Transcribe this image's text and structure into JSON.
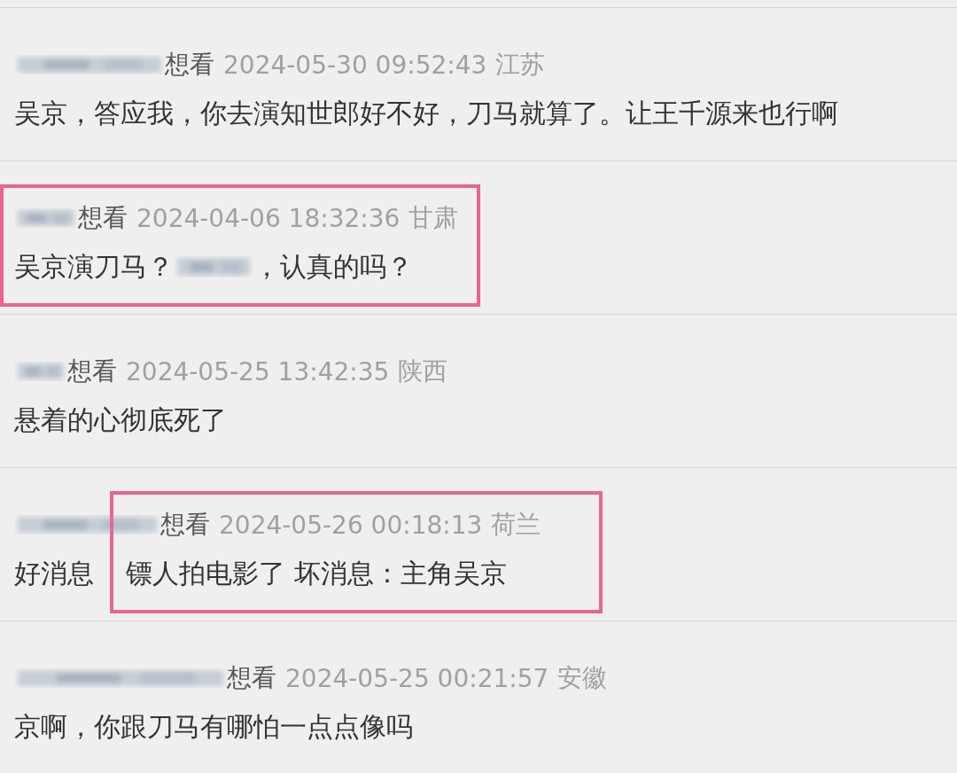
{
  "comments": [
    {
      "reaction": "想看",
      "date": "2024-05-30 09:52:43",
      "location": "江苏",
      "segments": [
        {
          "kind": "text",
          "text": "吴京，答应我，你去演知世郎好不好，刀马就算了。让王千源来也行啊"
        }
      ],
      "highlighted": false
    },
    {
      "reaction": "想看",
      "date": "2024-04-06 18:32:36",
      "location": "甘肃",
      "segments": [
        {
          "kind": "text",
          "text": "吴京演刀马？"
        },
        {
          "kind": "redacted"
        },
        {
          "kind": "text",
          "text": "，认真的吗？"
        }
      ],
      "highlighted": true,
      "name_outside_highlight": false
    },
    {
      "reaction": "想看",
      "date": "2024-05-25 13:42:35",
      "location": "陕西",
      "segments": [
        {
          "kind": "text",
          "text": "悬着的心彻底死了"
        }
      ],
      "highlighted": false
    },
    {
      "reaction": "想看",
      "date": "2024-05-26 00:18:13",
      "location": "荷兰",
      "segments": [
        {
          "kind": "text",
          "text": "好消息"
        },
        {
          "kind": "text",
          "text": "镖人拍电影了 坏消息：主角吴京"
        }
      ],
      "highlighted": true,
      "name_outside_highlight": true
    },
    {
      "reaction": "想看",
      "date": "2024-05-25 00:21:57",
      "location": "安徽",
      "segments": [
        {
          "kind": "text",
          "text": "京啊，你跟刀马有哪怕一点点像吗"
        }
      ],
      "highlighted": false
    }
  ]
}
